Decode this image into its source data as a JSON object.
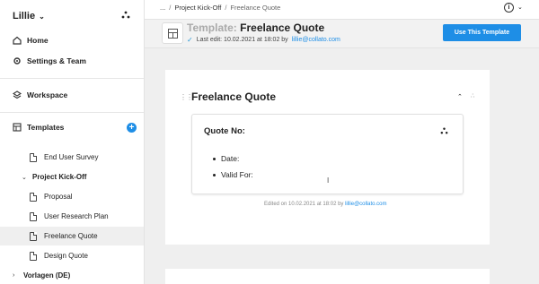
{
  "workspace": {
    "name": "Lillie"
  },
  "sidebar": {
    "nav": [
      {
        "label": "Home",
        "icon": "home-icon"
      },
      {
        "label": "Settings & Team",
        "icon": "gear-icon"
      },
      {
        "label": "Workspace",
        "icon": "layers-icon"
      },
      {
        "label": "Templates",
        "icon": "template-icon"
      }
    ],
    "tree": [
      {
        "label": "End User Survey",
        "type": "doc"
      },
      {
        "label": "Project Kick-Off",
        "type": "folder",
        "expanded": true
      },
      {
        "label": "Proposal",
        "type": "doc"
      },
      {
        "label": "User Research Plan",
        "type": "doc"
      },
      {
        "label": "Freelance Quote",
        "type": "doc",
        "active": true
      },
      {
        "label": "Design Quote",
        "type": "doc"
      },
      {
        "label": "Vorlagen (DE)",
        "type": "folder",
        "expanded": false
      }
    ]
  },
  "breadcrumb": {
    "root": "...",
    "sep": "/",
    "parent": "Project Kick-Off",
    "current": "Freelance Quote"
  },
  "header": {
    "prefix": "Template:",
    "title": "Freelance Quote",
    "last_edit_label": "Last edit: 10.02.2021 at 18:02 by",
    "last_edit_user": "lillie@collato.com",
    "button": "Use This Template"
  },
  "document": {
    "section_title": "Freelance Quote",
    "card_title": "Quote No:",
    "bullets": [
      "Date:",
      "Valid For:"
    ],
    "edited_label": "Edited on 10.02.2021 at 18:02 by",
    "edited_user": "lillie@collato.com"
  },
  "colors": {
    "accent": "#1e8ee6",
    "canvas_bg": "#efefef"
  }
}
